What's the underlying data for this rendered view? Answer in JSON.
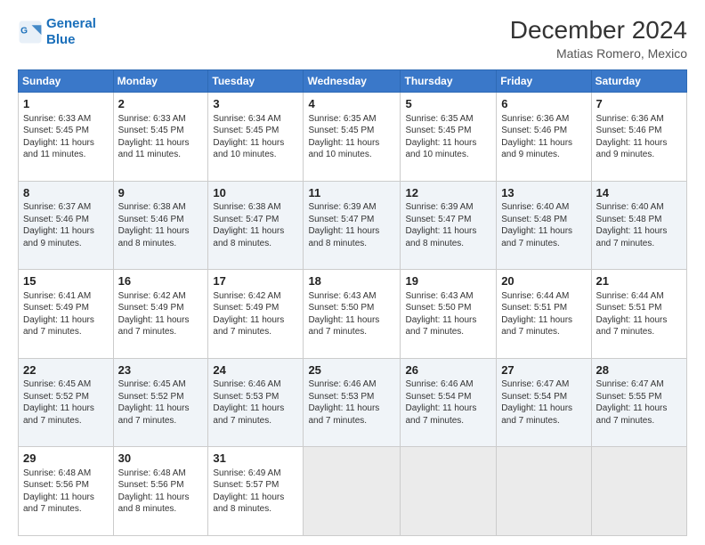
{
  "header": {
    "logo_line1": "General",
    "logo_line2": "Blue",
    "title": "December 2024",
    "subtitle": "Matias Romero, Mexico"
  },
  "days_of_week": [
    "Sunday",
    "Monday",
    "Tuesday",
    "Wednesday",
    "Thursday",
    "Friday",
    "Saturday"
  ],
  "weeks": [
    [
      {
        "day": 1,
        "info": "Sunrise: 6:33 AM\nSunset: 5:45 PM\nDaylight: 11 hours\nand 11 minutes."
      },
      {
        "day": 2,
        "info": "Sunrise: 6:33 AM\nSunset: 5:45 PM\nDaylight: 11 hours\nand 11 minutes."
      },
      {
        "day": 3,
        "info": "Sunrise: 6:34 AM\nSunset: 5:45 PM\nDaylight: 11 hours\nand 10 minutes."
      },
      {
        "day": 4,
        "info": "Sunrise: 6:35 AM\nSunset: 5:45 PM\nDaylight: 11 hours\nand 10 minutes."
      },
      {
        "day": 5,
        "info": "Sunrise: 6:35 AM\nSunset: 5:45 PM\nDaylight: 11 hours\nand 10 minutes."
      },
      {
        "day": 6,
        "info": "Sunrise: 6:36 AM\nSunset: 5:46 PM\nDaylight: 11 hours\nand 9 minutes."
      },
      {
        "day": 7,
        "info": "Sunrise: 6:36 AM\nSunset: 5:46 PM\nDaylight: 11 hours\nand 9 minutes."
      }
    ],
    [
      {
        "day": 8,
        "info": "Sunrise: 6:37 AM\nSunset: 5:46 PM\nDaylight: 11 hours\nand 9 minutes."
      },
      {
        "day": 9,
        "info": "Sunrise: 6:38 AM\nSunset: 5:46 PM\nDaylight: 11 hours\nand 8 minutes."
      },
      {
        "day": 10,
        "info": "Sunrise: 6:38 AM\nSunset: 5:47 PM\nDaylight: 11 hours\nand 8 minutes."
      },
      {
        "day": 11,
        "info": "Sunrise: 6:39 AM\nSunset: 5:47 PM\nDaylight: 11 hours\nand 8 minutes."
      },
      {
        "day": 12,
        "info": "Sunrise: 6:39 AM\nSunset: 5:47 PM\nDaylight: 11 hours\nand 8 minutes."
      },
      {
        "day": 13,
        "info": "Sunrise: 6:40 AM\nSunset: 5:48 PM\nDaylight: 11 hours\nand 7 minutes."
      },
      {
        "day": 14,
        "info": "Sunrise: 6:40 AM\nSunset: 5:48 PM\nDaylight: 11 hours\nand 7 minutes."
      }
    ],
    [
      {
        "day": 15,
        "info": "Sunrise: 6:41 AM\nSunset: 5:49 PM\nDaylight: 11 hours\nand 7 minutes."
      },
      {
        "day": 16,
        "info": "Sunrise: 6:42 AM\nSunset: 5:49 PM\nDaylight: 11 hours\nand 7 minutes."
      },
      {
        "day": 17,
        "info": "Sunrise: 6:42 AM\nSunset: 5:49 PM\nDaylight: 11 hours\nand 7 minutes."
      },
      {
        "day": 18,
        "info": "Sunrise: 6:43 AM\nSunset: 5:50 PM\nDaylight: 11 hours\nand 7 minutes."
      },
      {
        "day": 19,
        "info": "Sunrise: 6:43 AM\nSunset: 5:50 PM\nDaylight: 11 hours\nand 7 minutes."
      },
      {
        "day": 20,
        "info": "Sunrise: 6:44 AM\nSunset: 5:51 PM\nDaylight: 11 hours\nand 7 minutes."
      },
      {
        "day": 21,
        "info": "Sunrise: 6:44 AM\nSunset: 5:51 PM\nDaylight: 11 hours\nand 7 minutes."
      }
    ],
    [
      {
        "day": 22,
        "info": "Sunrise: 6:45 AM\nSunset: 5:52 PM\nDaylight: 11 hours\nand 7 minutes."
      },
      {
        "day": 23,
        "info": "Sunrise: 6:45 AM\nSunset: 5:52 PM\nDaylight: 11 hours\nand 7 minutes."
      },
      {
        "day": 24,
        "info": "Sunrise: 6:46 AM\nSunset: 5:53 PM\nDaylight: 11 hours\nand 7 minutes."
      },
      {
        "day": 25,
        "info": "Sunrise: 6:46 AM\nSunset: 5:53 PM\nDaylight: 11 hours\nand 7 minutes."
      },
      {
        "day": 26,
        "info": "Sunrise: 6:46 AM\nSunset: 5:54 PM\nDaylight: 11 hours\nand 7 minutes."
      },
      {
        "day": 27,
        "info": "Sunrise: 6:47 AM\nSunset: 5:54 PM\nDaylight: 11 hours\nand 7 minutes."
      },
      {
        "day": 28,
        "info": "Sunrise: 6:47 AM\nSunset: 5:55 PM\nDaylight: 11 hours\nand 7 minutes."
      }
    ],
    [
      {
        "day": 29,
        "info": "Sunrise: 6:48 AM\nSunset: 5:56 PM\nDaylight: 11 hours\nand 7 minutes."
      },
      {
        "day": 30,
        "info": "Sunrise: 6:48 AM\nSunset: 5:56 PM\nDaylight: 11 hours\nand 8 minutes."
      },
      {
        "day": 31,
        "info": "Sunrise: 6:49 AM\nSunset: 5:57 PM\nDaylight: 11 hours\nand 8 minutes."
      },
      null,
      null,
      null,
      null
    ]
  ]
}
